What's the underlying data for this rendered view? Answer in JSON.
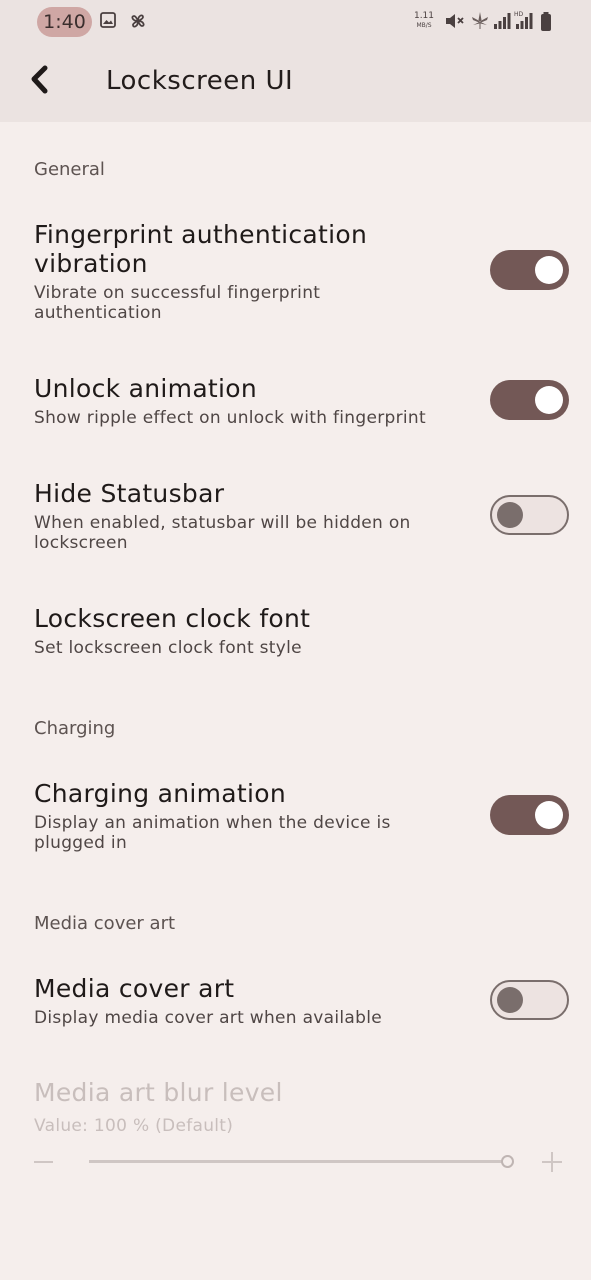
{
  "status_bar": {
    "time": "1:40",
    "net_speed_value": "1.11",
    "net_speed_unit": "MB/S",
    "icons": [
      "gallery-icon",
      "pinwheel-icon",
      "mute-icon",
      "cannabis-leaf-icon",
      "signal-icon",
      "hd-signal-icon",
      "battery-icon"
    ]
  },
  "toolbar": {
    "title": "Lockscreen UI",
    "back_icon": "chevron-left-icon"
  },
  "sections": {
    "general": {
      "header": "General",
      "fingerprint": {
        "title_line1": "Fingerprint authentication",
        "title_line2": "vibration",
        "summary_line1": "Vibrate on successful fingerprint",
        "summary_line2": "authentication",
        "enabled": true
      },
      "unlock_animation": {
        "title": "Unlock animation",
        "summary": "Show ripple effect on unlock with fingerprint",
        "enabled": true
      },
      "hide_statusbar": {
        "title": "Hide Statusbar",
        "summary_line1": "When enabled, statusbar will be hidden on",
        "summary_line2": "lockscreen",
        "enabled": false
      },
      "clock_font": {
        "title": "Lockscreen clock font",
        "summary": "Set lockscreen clock font style"
      }
    },
    "charging": {
      "header": "Charging",
      "charging_animation": {
        "title": "Charging animation",
        "summary_line1": "Display an animation when the device is",
        "summary_line2": "plugged in",
        "enabled": true
      }
    },
    "media": {
      "header": "Media cover art",
      "media_cover_art": {
        "title": "Media cover art",
        "summary": "Display media cover art when available",
        "enabled": false
      },
      "blur_level": {
        "title": "Media art blur level",
        "value_text": "Value: 100 % (Default)",
        "value_percent": 100,
        "enabled": false
      }
    }
  },
  "colors": {
    "background": "#f5eeec",
    "toolbar": "#ebe3e1",
    "switch_on": "#735856",
    "time_pill": "#cfa7a4"
  }
}
